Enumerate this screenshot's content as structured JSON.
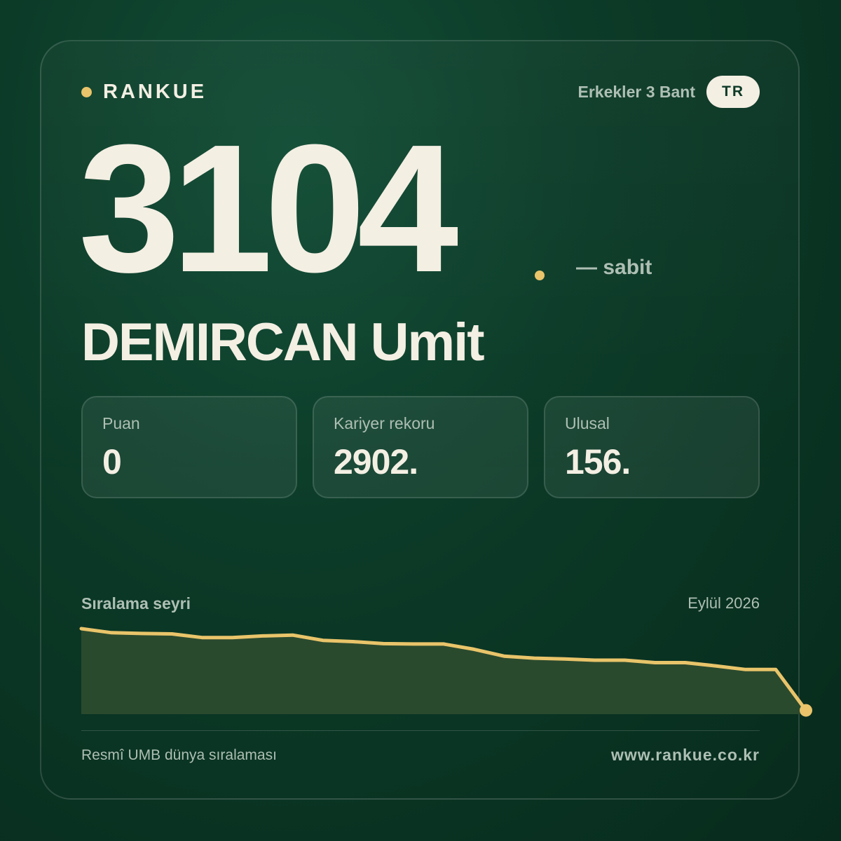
{
  "brand": {
    "name": "RANKUE"
  },
  "header": {
    "division": "Erkekler 3 Bant",
    "country_code": "TR"
  },
  "ranking": {
    "world_rank": "3104",
    "change_label": "— sabit"
  },
  "player": {
    "name": "DEMIRCAN Umit"
  },
  "stats": [
    {
      "label": "Puan",
      "value": "0"
    },
    {
      "label": "Kariyer rekoru",
      "value": "2902."
    },
    {
      "label": "Ulusal",
      "value": "156."
    }
  ],
  "trend": {
    "title": "Sıralama seyri",
    "date": "Eylül 2026"
  },
  "chart_data": {
    "type": "area",
    "title": "Sıralama seyri",
    "y_inverted": true,
    "ylim": [
      3103,
      2902
    ],
    "values": [
      2902,
      2912,
      2914,
      2915,
      2924,
      2924,
      2920,
      2918,
      2931,
      2934,
      2939,
      2940,
      2940,
      2953,
      2970,
      2975,
      2977,
      2980,
      2980,
      2986,
      2986,
      2994,
      3003,
      3003,
      3104
    ],
    "line_color": "#e9c46a",
    "fill_color": "#2a4a2e",
    "end_marker": true
  },
  "footer": {
    "source": "Resmî UMB dünya sıralaması",
    "website": "www.rankue.co.kr"
  },
  "colors": {
    "accent": "#e9c46a",
    "background": "#0c3b28",
    "text": "#f4efe3",
    "muted": "#aebfb4"
  }
}
